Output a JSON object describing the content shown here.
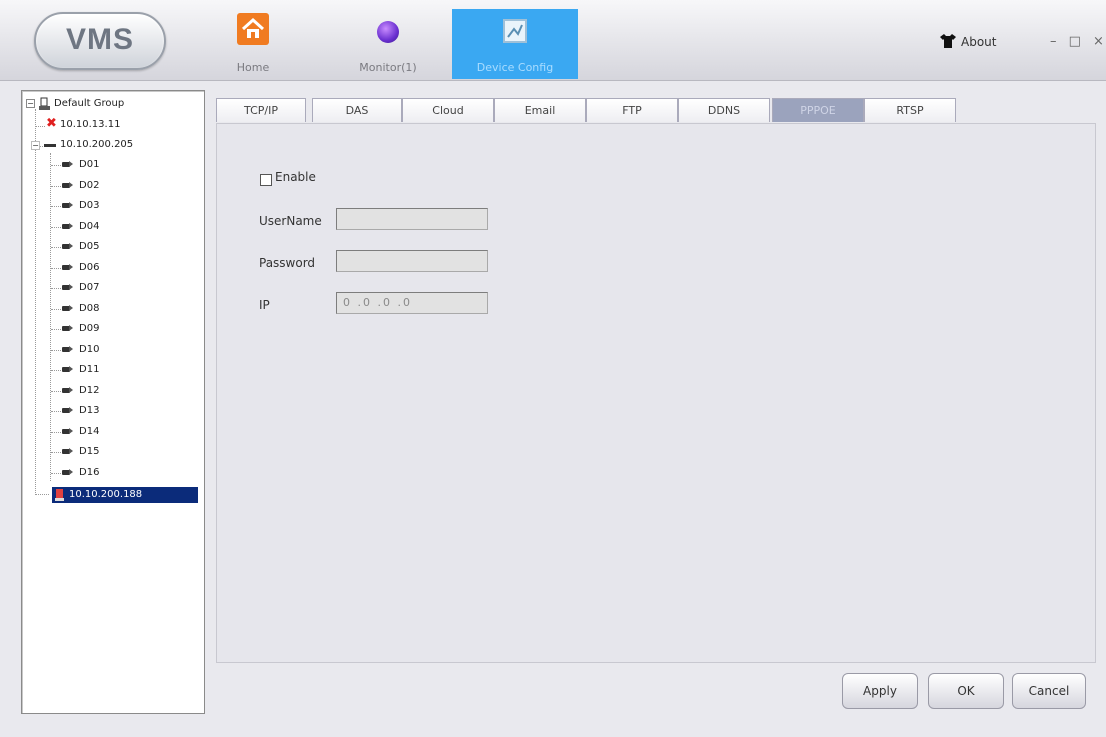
{
  "app": {
    "logo_text": "VMS"
  },
  "nav": {
    "home": "Home",
    "monitor": "Monitor(1)",
    "device_config": "Device Config",
    "about": "About",
    "window_controls": "– □ ×"
  },
  "tree": {
    "root": "Default Group",
    "devices": [
      {
        "label": "10.10.13.11",
        "status": "offline"
      },
      {
        "label": "10.10.200.205",
        "status": "online"
      },
      {
        "label": "10.10.200.188",
        "status": "selected"
      }
    ],
    "channels": [
      "D01",
      "D02",
      "D03",
      "D04",
      "D05",
      "D06",
      "D07",
      "D08",
      "D09",
      "D10",
      "D11",
      "D12",
      "D13",
      "D14",
      "D15",
      "D16"
    ]
  },
  "tabs": [
    "TCP/IP",
    "DAS",
    "Cloud",
    "Email",
    "FTP",
    "DDNS",
    "PPPOE",
    "RTSP"
  ],
  "active_tab": "PPPOE",
  "form": {
    "enable_label": "Enable",
    "enable_checked": false,
    "username_label": "UserName",
    "username_value": "",
    "password_label": "Password",
    "password_value": "",
    "ip_label": "IP",
    "ip_value": "0 .0 .0 .0"
  },
  "buttons": {
    "apply": "Apply",
    "ok": "OK",
    "cancel": "Cancel"
  },
  "colors": {
    "active_nav": "#3aa8f2",
    "active_tab": "#9ba3bd",
    "tree_selection": "#0b2b7a",
    "offline_marker": "#e02020"
  }
}
